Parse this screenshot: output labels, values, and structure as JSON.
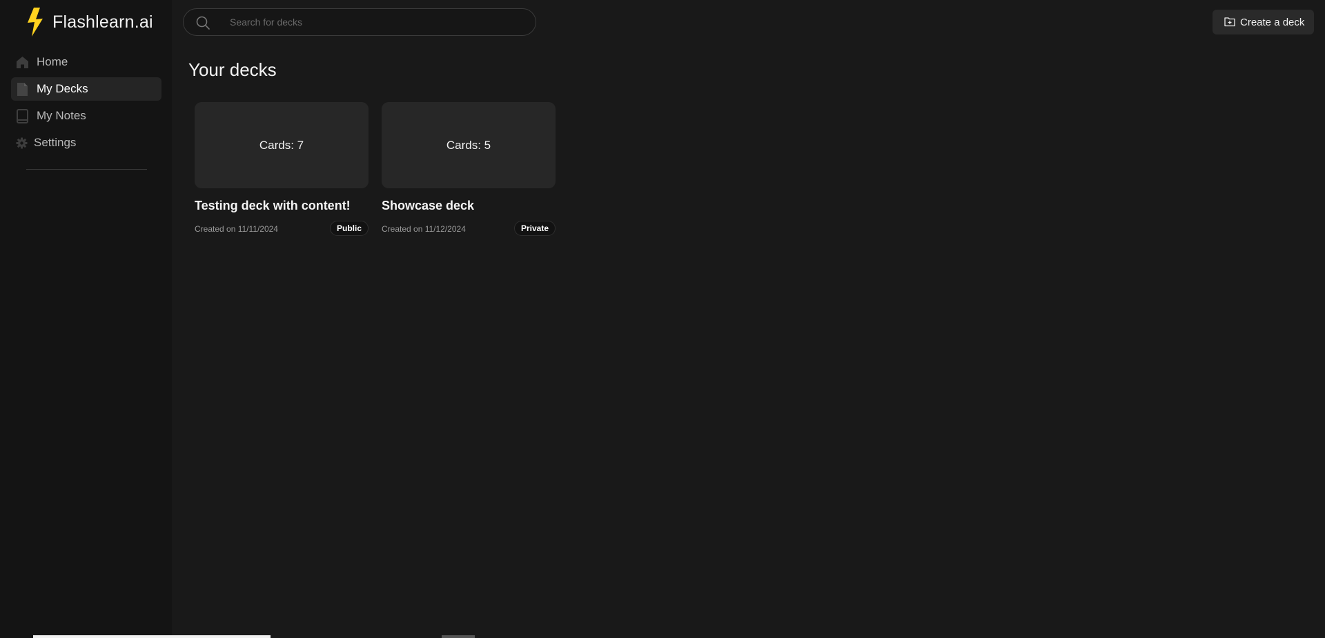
{
  "brand": {
    "name": "Flashlearn.ai",
    "icon": "lightning-bolt-icon",
    "accent": "#FFD21F"
  },
  "sidebar": {
    "items": [
      {
        "label": "Home",
        "icon": "home-icon",
        "active": false
      },
      {
        "label": "My Decks",
        "icon": "file-icon",
        "active": true
      },
      {
        "label": "My Notes",
        "icon": "book-icon",
        "active": false
      },
      {
        "label": "Settings",
        "icon": "gear-icon",
        "active": false
      }
    ]
  },
  "search": {
    "placeholder": "Search for decks",
    "value": ""
  },
  "header": {
    "create_label": "Create a deck",
    "create_icon": "folder-plus-icon"
  },
  "main": {
    "title": "Your decks",
    "decks": [
      {
        "cards": "Cards: 7",
        "title": "Testing deck with content!",
        "created": "Created on 11/11/2024",
        "visibility": "Public"
      },
      {
        "cards": "Cards: 5",
        "title": "Showcase deck",
        "created": "Created on 11/12/2024",
        "visibility": "Private"
      }
    ]
  },
  "colors": {
    "background": "#191919",
    "sidebar": "#141414",
    "card": "#272727"
  }
}
